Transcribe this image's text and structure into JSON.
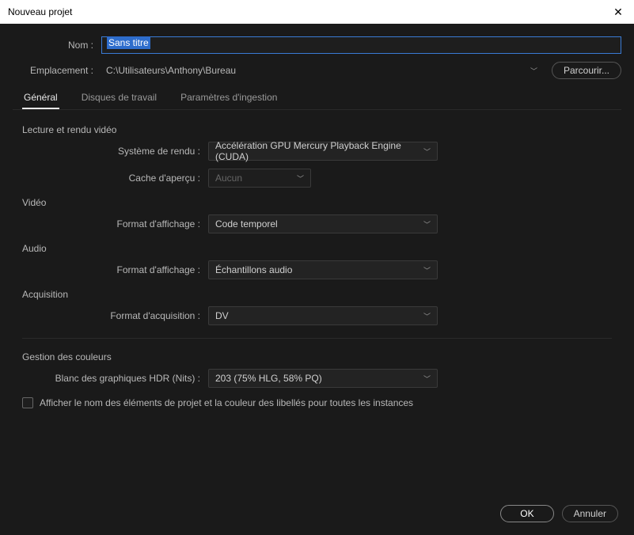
{
  "title": "Nouveau projet",
  "name_label": "Nom :",
  "name_value": "Sans titre",
  "location_label": "Emplacement :",
  "location_value": "C:\\Utilisateurs\\Anthony\\Bureau",
  "browse_label": "Parcourir...",
  "tabs": {
    "general": "Général",
    "scratch": "Disques de travail",
    "ingest": "Paramètres d'ingestion"
  },
  "groups": {
    "video_render": {
      "title": "Lecture et rendu vidéo",
      "renderer_label": "Système de rendu :",
      "renderer_value": "Accélération GPU Mercury Playback Engine (CUDA)",
      "cache_label": "Cache d'aperçu :",
      "cache_value": "Aucun"
    },
    "video": {
      "title": "Vidéo",
      "format_label": "Format d'affichage :",
      "format_value": "Code temporel"
    },
    "audio": {
      "title": "Audio",
      "format_label": "Format d'affichage :",
      "format_value": "Échantillons audio"
    },
    "capture": {
      "title": "Acquisition",
      "format_label": "Format d'acquisition :",
      "format_value": "DV"
    },
    "color": {
      "title": "Gestion des couleurs",
      "hdr_label": "Blanc des graphiques HDR (Nits) :",
      "hdr_value": "203 (75% HLG, 58% PQ)"
    }
  },
  "checkbox_label": "Afficher le nom des éléments de projet et la couleur des libellés pour toutes les instances",
  "ok_label": "OK",
  "cancel_label": "Annuler"
}
